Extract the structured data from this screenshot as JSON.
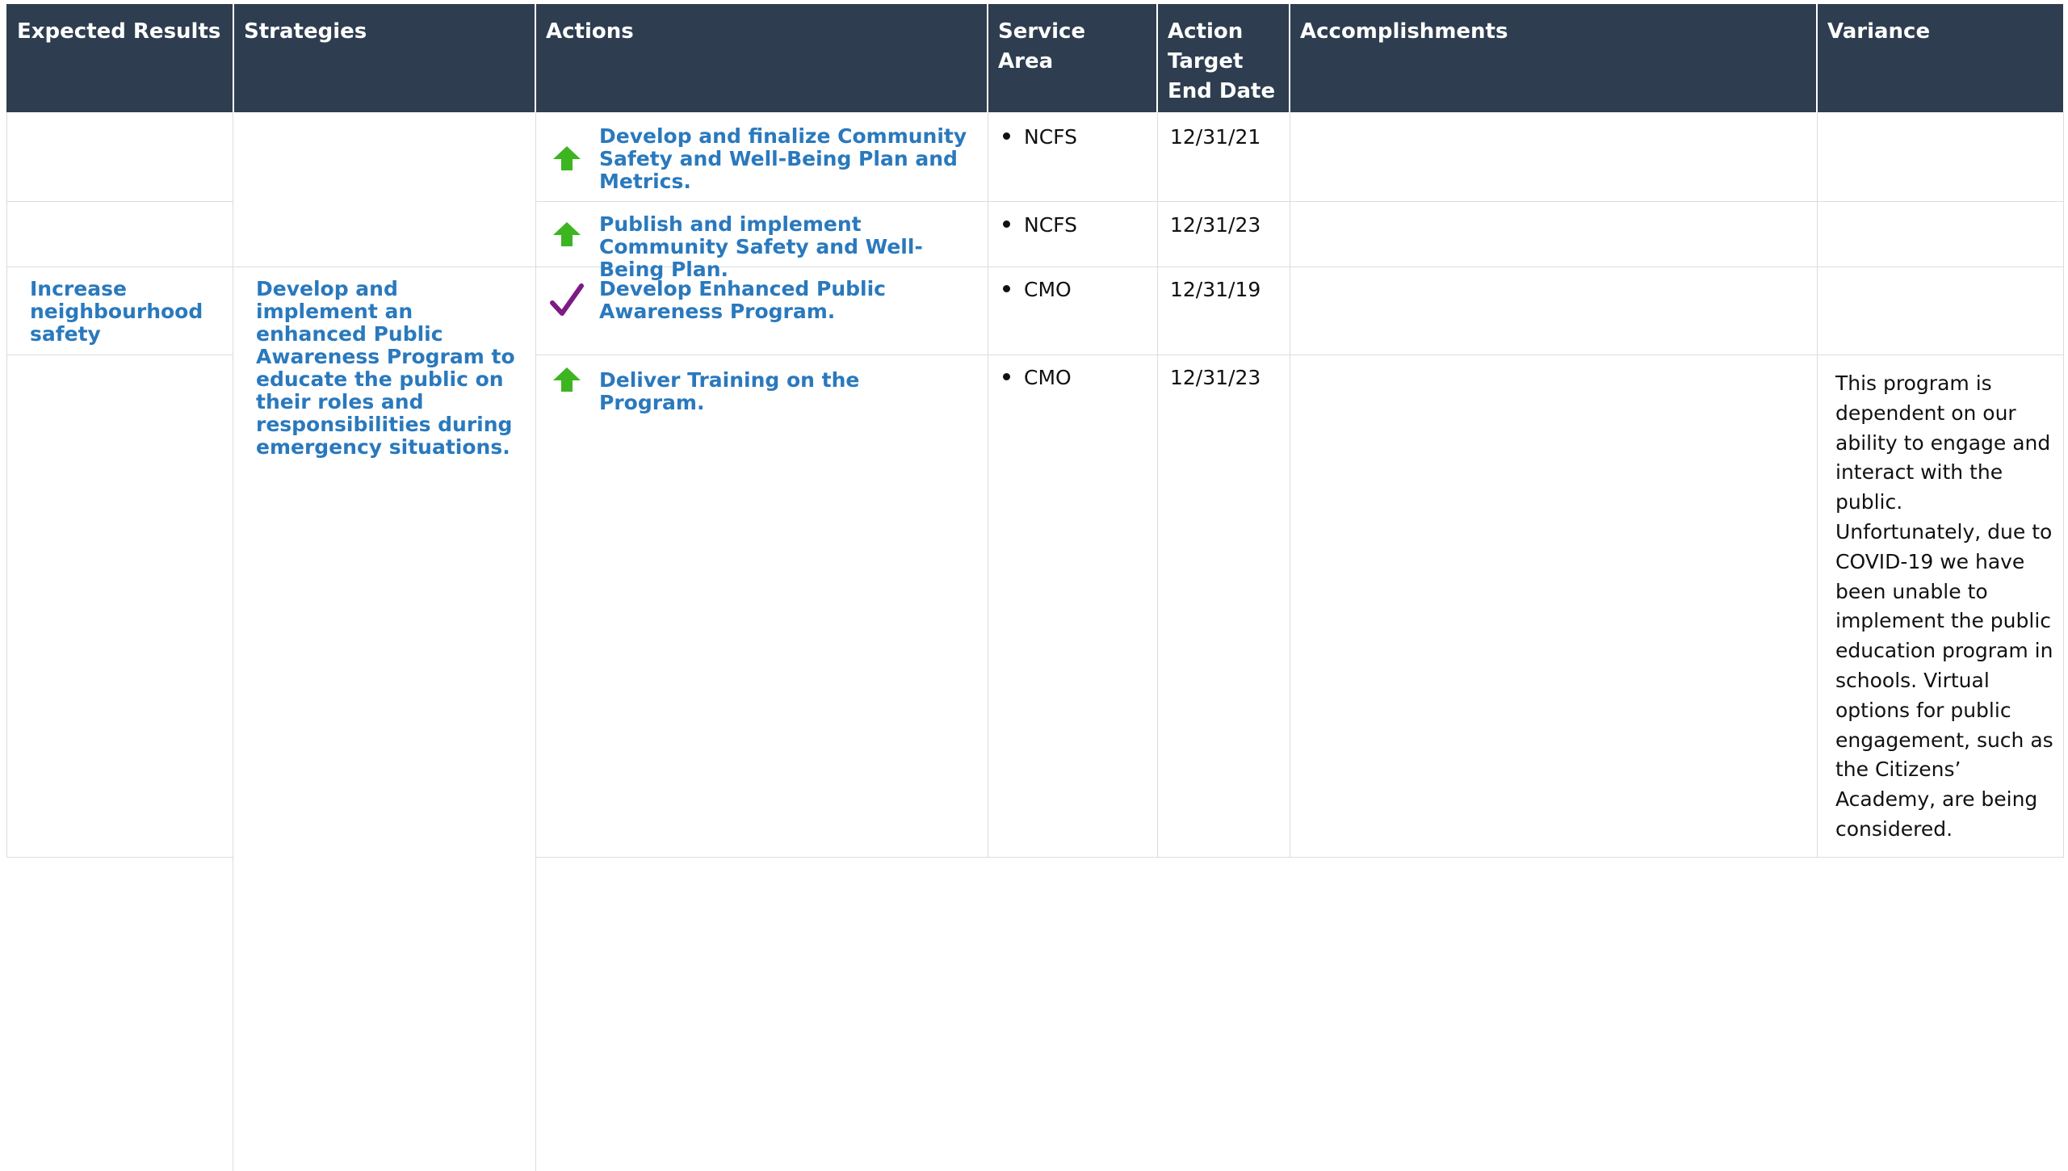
{
  "colors": {
    "header_bg": "#2e3e50",
    "header_text": "#ffffff",
    "link_text": "#2a79bd",
    "grid_line": "#dcdcdc",
    "status_arrow": "#3cb521",
    "status_check": "#7d1a83"
  },
  "table": {
    "headers": {
      "expected_results": "Expected Results",
      "strategies": "Strategies",
      "actions": "Actions",
      "service_area": "Service Area",
      "target_end_date": "Action Target End Date",
      "accomplishments": "Accomplishments",
      "variance": "Variance"
    },
    "expected_result": "Increase neighbourhood safety",
    "strategy": "Develop and implement an enhanced Public Awareness Program to educate the public on their roles and responsibilities during emergency situations.",
    "rows": [
      {
        "status_icon": "up-arrow-icon",
        "action": "Develop and finalize Community Safety and Well-Being Plan and Metrics.",
        "service_area": "NCFS",
        "target_end_date": "12/31/21",
        "accomplishments": "",
        "variance": ""
      },
      {
        "status_icon": "up-arrow-icon",
        "action": "Publish and implement Community Safety and Well-Being Plan.",
        "service_area": "NCFS",
        "target_end_date": "12/31/23",
        "accomplishments": "",
        "variance": ""
      },
      {
        "status_icon": "checkmark-icon",
        "action": "Develop Enhanced Public Awareness Program.",
        "service_area": "CMO",
        "target_end_date": "12/31/19",
        "accomplishments": "",
        "variance": ""
      },
      {
        "status_icon": "up-arrow-icon",
        "action": "Deliver Training on the Program.",
        "service_area": "CMO",
        "target_end_date": "12/31/23",
        "accomplishments": "",
        "variance": "This program is dependent on our ability to engage and interact with the public. Unfortunately, due to COVID-19 we have been unable to implement the public education program in schools. Virtual options for public engagement, such as the Citizens’ Academy, are being considered."
      }
    ]
  }
}
